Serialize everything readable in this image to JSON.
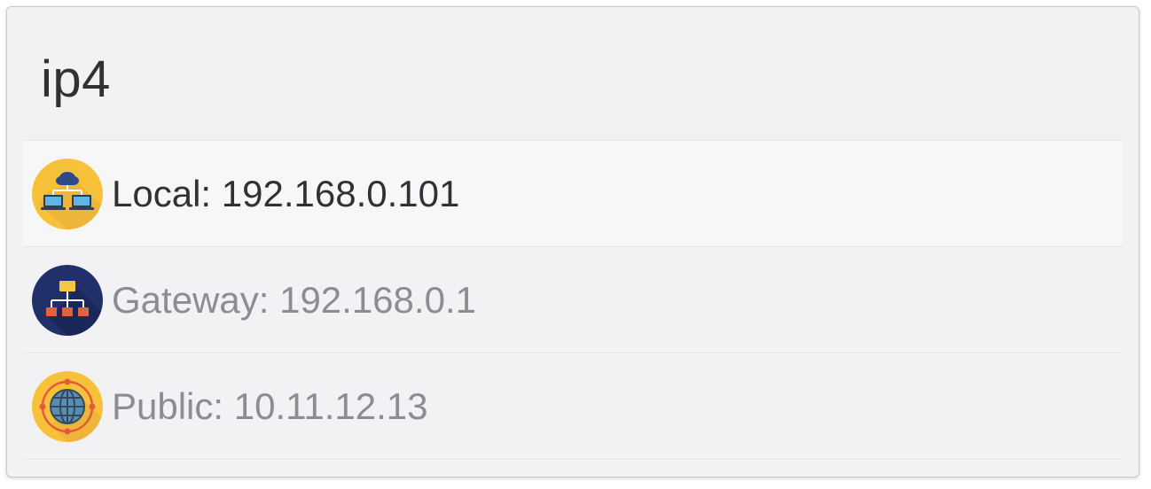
{
  "panel": {
    "title": "ip4"
  },
  "entries": [
    {
      "label": "Local: 192.168.0.101",
      "icon": "local-network-icon",
      "selected": true
    },
    {
      "label": "Gateway: 192.168.0.1",
      "icon": "gateway-hierarchy-icon",
      "selected": false
    },
    {
      "label": "Public: 10.11.12.13",
      "icon": "globe-icon",
      "selected": false
    }
  ],
  "colors": {
    "background": "#f2f2f4",
    "selected_row": "#f7f7f8",
    "text_selected": "#2f3235",
    "text_muted": "#8a8d91",
    "title_text": "#2f3133",
    "local_icon_bg": "#f7c23a",
    "gateway_icon_bg": "#22306a",
    "public_icon_bg": "#f7c23a"
  }
}
